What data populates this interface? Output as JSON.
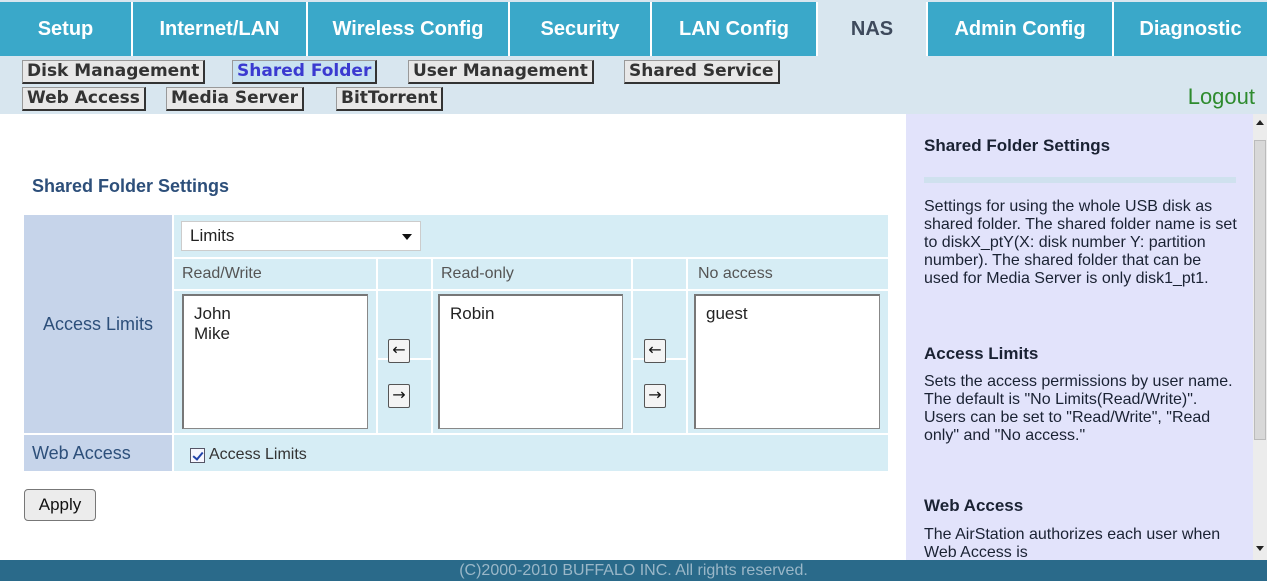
{
  "nav": {
    "tabs": [
      "Setup",
      "Internet/LAN",
      "Wireless Config",
      "Security",
      "LAN Config",
      "NAS",
      "Admin Config",
      "Diagnostic"
    ],
    "active_tab": "NAS"
  },
  "subnav": {
    "items": [
      "Disk Management",
      "Shared Folder",
      "User Management",
      "Shared Service",
      "Web Access",
      "Media Server",
      "BitTorrent"
    ],
    "active": "Shared Folder",
    "logout": "Logout"
  },
  "main": {
    "title": "Shared Folder Settings",
    "access_limits_label": "Access Limits",
    "mode_select_value": "Limits",
    "col_read_write": "Read/Write",
    "col_read_only": "Read-only",
    "col_no_access": "No access",
    "read_write_users": [
      "John",
      "Mike"
    ],
    "read_only_users": [
      "Robin"
    ],
    "no_access_users": [
      "guest"
    ],
    "arrow_left": "←",
    "arrow_right": "→",
    "web_access_label": "Web Access",
    "web_access_checkbox_label": "Access Limits",
    "apply_label": "Apply"
  },
  "help": {
    "title": "Shared Folder Settings",
    "intro": "Settings for using the whole USB disk as shared folder. The shared folder name is set to diskX_ptY(X: disk number Y: partition number). The shared folder that can be used for Media Server is only disk1_pt1.",
    "access_limits_heading": "Access Limits",
    "access_limits_text": "Sets the access permissions by user name. The default is \"No Limits(Read/Write)\". Users can be set to \"Read/Write\", \"Read only\" and \"No access.\"",
    "web_access_heading": "Web Access",
    "web_access_text": "The AirStation authorizes each user when Web Access is"
  },
  "footer": "(C)2000-2010 BUFFALO INC. All rights reserved.",
  "colors": {
    "tab": "#3aa8c9",
    "header_bg": "#d8e6ef",
    "help_bg": "#e2e3fb",
    "footer": "#2a6a8a",
    "logout": "#2e8b2e"
  }
}
